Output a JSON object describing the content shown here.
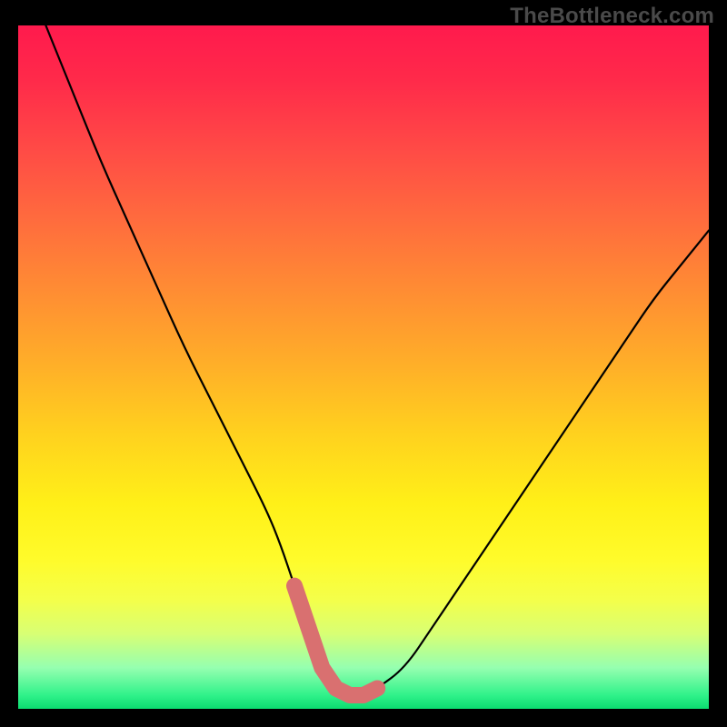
{
  "watermark": "TheBottleneck.com",
  "colors": {
    "curve": "#000000",
    "highlight": "#d97070",
    "background_top": "#ff1a4d",
    "background_bottom": "#0bdc70",
    "frame": "#000000"
  },
  "chart_data": {
    "type": "line",
    "title": "",
    "xlabel": "",
    "ylabel": "",
    "xlim": [
      0,
      100
    ],
    "ylim": [
      0,
      100
    ],
    "grid": false,
    "annotations": [
      "TheBottleneck.com"
    ],
    "legend": false,
    "series": [
      {
        "name": "bottleneck-curve",
        "x": [
          4,
          8,
          12,
          16,
          20,
          24,
          28,
          32,
          36,
          38,
          40,
          42,
          44,
          46,
          48,
          50,
          52,
          56,
          60,
          64,
          68,
          72,
          76,
          80,
          84,
          88,
          92,
          96,
          100
        ],
        "y": [
          100,
          90,
          80,
          71,
          62,
          53,
          45,
          37,
          29,
          24,
          18,
          12,
          6,
          3,
          2,
          2,
          3,
          6,
          12,
          18,
          24,
          30,
          36,
          42,
          48,
          54,
          60,
          65,
          70
        ]
      }
    ],
    "highlight_region": {
      "name": "optimal-range",
      "x": [
        40,
        42,
        44,
        46,
        48,
        50,
        52
      ],
      "y": [
        18,
        12,
        6,
        3,
        2,
        2,
        3
      ]
    }
  }
}
